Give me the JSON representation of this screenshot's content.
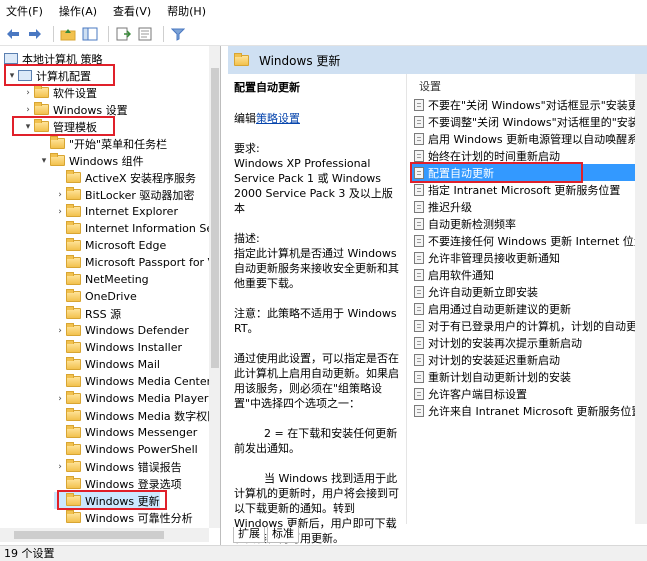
{
  "menu": {
    "file": "文件(F)",
    "action": "操作(A)",
    "view": "查看(V)",
    "help": "帮助(H)"
  },
  "toolbar": {
    "icons": [
      "back-arrow-icon",
      "forward-arrow-icon",
      "up-folder-icon",
      "show-tree-icon",
      "export-list-icon",
      "properties-icon",
      "filter-icon"
    ]
  },
  "tree": {
    "items": [
      "本地计算机 策略",
      "计算机配置",
      "软件设置",
      "Windows 设置",
      "管理模板",
      "\"开始\"菜单和任务栏",
      "Windows 组件",
      "ActiveX 安装程序服务",
      "BitLocker 驱动器加密",
      "Internet Explorer",
      "Internet Information Ser",
      "Microsoft Edge",
      "Microsoft Passport for V",
      "NetMeeting",
      "OneDrive",
      "RSS 源",
      "Windows Defender",
      "Windows Installer",
      "Windows Mail",
      "Windows Media Center",
      "Windows Media Player",
      "Windows Media 数字权限",
      "Windows Messenger",
      "Windows PowerShell",
      "Windows 错误报告",
      "Windows 登录选项",
      "Windows 更新",
      "Windows 可靠性分析"
    ]
  },
  "right": {
    "header_title": "Windows 更新",
    "desc_title": "配置自动更新",
    "edit_prefix": "编辑",
    "edit_link": "策略设置",
    "requirements": "要求:\nWindows XP Professional Service Pack 1 或 Windows 2000 Service Pack 3 及以上版本",
    "description": "描述:\n指定此计算机是否通过 Windows 自动更新服务来接收安全更新和其他重要下载。",
    "note": "注意：此策略不适用于 Windows RT。",
    "usage": "通过使用此设置，可以指定是否在此计算机上启用自动更新。如果启用该服务，则必须在\"组策略设置\"中选择四个选项之一：",
    "option2": "2 = 在下载和安装任何更新前发出通知。",
    "option2_detail": "当 Windows 找到适用于此计算机的更新时，用户将会接到可以下载更新的通知。转到 Windows 更新后，用户即可下载和安装任何可用更新。",
    "settings_header": "设置",
    "settings": [
      "不要在\"关闭 Windows\"对话框显示\"安装更新并",
      "不要调整\"关闭 Windows\"对话框里的\"安装更新",
      "启用 Windows 更新电源管理以自动唤醒系统来",
      "始终在计划的时间重新启动",
      "配置自动更新",
      "指定 Intranet Microsoft 更新服务位置",
      "推迟升级",
      "自动更新检测频率",
      "不要连接任何 Windows 更新 Internet 位置",
      "允许非管理员接收更新通知",
      "启用软件通知",
      "允许自动更新立即安装",
      "启用通过自动更新建议的更新",
      "对于有已登录用户的计算机，计划的自动更新安",
      "对计划的安装再次提示重新启动",
      "对计划的安装延迟重新启动",
      "重新计划自动更新计划的安装",
      "允许客户端目标设置",
      "允许来自 Intranet Microsoft 更新服务位置的签"
    ],
    "selected_index": 4
  },
  "tabs": {
    "extended": "扩展",
    "standard": "标准"
  },
  "status": "19 个设置"
}
